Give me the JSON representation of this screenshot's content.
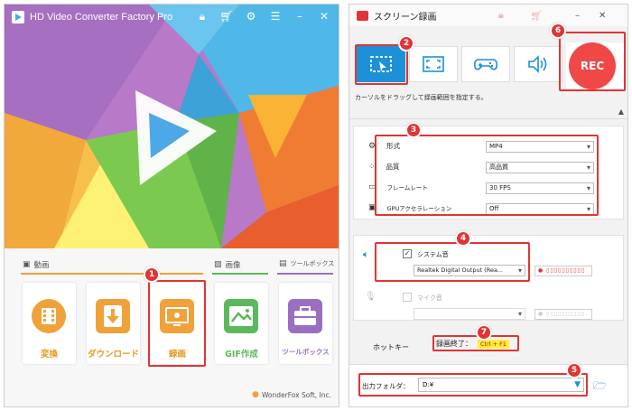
{
  "left_window": {
    "title": "HD Video Converter Factory Pro",
    "titlebar_icons": [
      "lock-icon",
      "cart-icon",
      "gear-icon",
      "list-icon",
      "minimize-icon",
      "close-icon"
    ],
    "sections": [
      {
        "icon": "film-icon",
        "label": "動画",
        "color": "#f0a23a"
      },
      {
        "icon": "image-icon",
        "label": "画像",
        "color": "#5cb85c"
      },
      {
        "icon": "toolbox-icon",
        "label": "ツールボックス",
        "color": "#9a6fc2"
      }
    ],
    "tiles": [
      {
        "label": "変換",
        "color": "#f0a23a"
      },
      {
        "label": "ダウンロード",
        "color": "#f0a23a"
      },
      {
        "label": "録画",
        "color": "#f0a23a"
      },
      {
        "label": "GIF作成",
        "color": "#5cb85c"
      },
      {
        "label": "ツールボックス",
        "color": "#9a6fc2"
      }
    ],
    "watermark": "WonderFox Soft, Inc."
  },
  "right_window": {
    "title": "スクリーン録画",
    "rec_label": "REC",
    "hint": "カーソルをドラッグして録画範囲を指定する。",
    "settings": [
      {
        "label": "形式",
        "value": "MP4",
        "icon": "format-icon"
      },
      {
        "label": "品質",
        "value": "高品質",
        "icon": "quality-icon"
      },
      {
        "label": "フレームレート",
        "value": "30 FPS",
        "icon": "framerate-icon"
      },
      {
        "label": "GPUアクセラレーション",
        "value": "Off",
        "icon": "gpu-icon"
      }
    ],
    "system_audio": {
      "label": "システム音",
      "checked": true,
      "device": "Realtek Digital Output (Rea..."
    },
    "mic": {
      "label": "マイク音",
      "checked": false,
      "device": ""
    },
    "hotkey": {
      "label": "ホットキー",
      "stop_label": "録画終了：",
      "stop_key": "Ctrl + F1"
    },
    "output": {
      "label": "出力フォルダ：",
      "value": "D:¥"
    }
  },
  "badges": [
    "1",
    "2",
    "3",
    "4",
    "5",
    "6",
    "7"
  ],
  "colors": {
    "accent": "#1e90d8",
    "highlight": "#e23434",
    "rec": "#f04747"
  }
}
